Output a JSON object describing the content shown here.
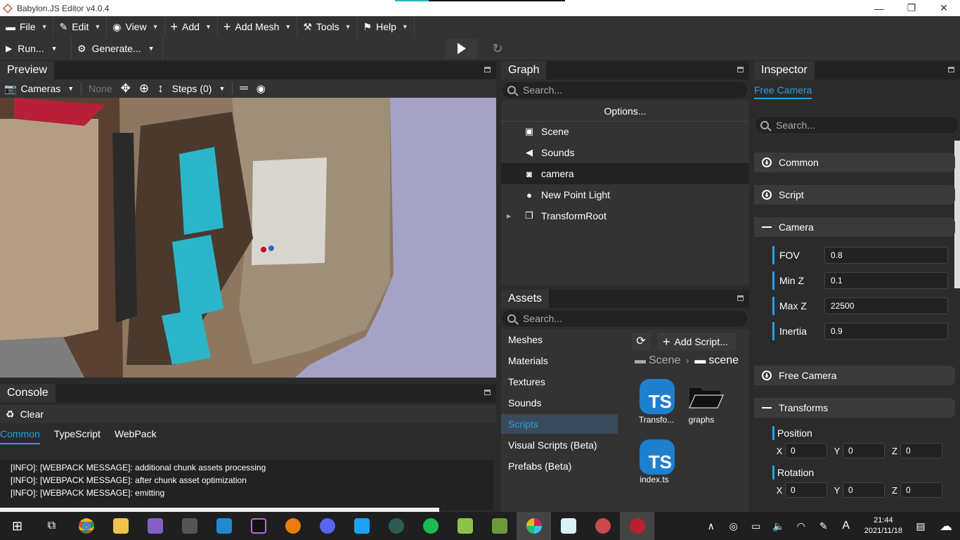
{
  "window": {
    "title": "Babylon.JS Editor v4.0.4",
    "minimize": "—",
    "restore": "❐",
    "close": "✕"
  },
  "menu": [
    {
      "icon": "folder-icon",
      "glyph": "▬",
      "label": "File"
    },
    {
      "icon": "edit-icon",
      "glyph": "✎",
      "label": "Edit"
    },
    {
      "icon": "eye-icon",
      "glyph": "◉",
      "label": "View"
    },
    {
      "icon": "plus-icon",
      "glyph": "+",
      "label": "Add"
    },
    {
      "icon": "plus-icon",
      "glyph": "+",
      "label": "Add Mesh"
    },
    {
      "icon": "wrench-icon",
      "glyph": "🔧",
      "label": "Tools"
    },
    {
      "icon": "signpost-icon",
      "glyph": "⚑",
      "label": "Help"
    }
  ],
  "toolbar": {
    "run": "Run...",
    "generate": "Generate..."
  },
  "preview": {
    "title": "Preview",
    "cameras": "Cameras",
    "none": "None",
    "steps": "Steps (0)"
  },
  "console": {
    "title": "Console",
    "clear": "Clear",
    "tabs": [
      "Common",
      "TypeScript",
      "WebPack"
    ],
    "lines": [
      "[INFO]: [WEBPACK MESSAGE]: additional chunk assets processing",
      "[INFO]: [WEBPACK MESSAGE]: after chunk asset optimization",
      "[INFO]: [WEBPACK MESSAGE]: emitting"
    ]
  },
  "graph": {
    "title": "Graph",
    "search_placeholder": "Search...",
    "options": "Options...",
    "nodes": [
      {
        "label": "Scene",
        "icon": "scene-icon"
      },
      {
        "label": "Sounds",
        "icon": "speaker-icon"
      },
      {
        "label": "camera",
        "icon": "camera-icon"
      },
      {
        "label": "New Point Light",
        "icon": "lightbulb-icon"
      },
      {
        "label": "TransformRoot",
        "icon": "copy-icon"
      }
    ]
  },
  "assets": {
    "title": "Assets",
    "search_placeholder": "Search...",
    "add_script": "Add Script...",
    "categories": [
      "Meshes",
      "Materials",
      "Textures",
      "Sounds",
      "Scripts",
      "Visual Scripts (Beta)",
      "Prefabs (Beta)"
    ],
    "selected_category": "Scripts",
    "breadcrumb": [
      "Scene",
      "scene"
    ],
    "items": [
      {
        "label": "Transfo...",
        "type": "ts"
      },
      {
        "label": "graphs",
        "type": "folder"
      },
      {
        "label": "index.ts",
        "type": "ts"
      }
    ],
    "ts_text": "TS"
  },
  "inspector": {
    "title": "Inspector",
    "tab": "Free Camera",
    "search_placeholder": "Search...",
    "sections": {
      "common": "Common",
      "script": "Script",
      "camera": "Camera",
      "free_camera": "Free Camera",
      "transforms": "Transforms"
    },
    "camera_props": [
      {
        "label": "FOV",
        "value": "0.8"
      },
      {
        "label": "Min Z",
        "value": "0.1"
      },
      {
        "label": "Max Z",
        "value": "22500"
      },
      {
        "label": "Inertia",
        "value": "0.9"
      }
    ],
    "position": {
      "label": "Position",
      "x": "0",
      "y": "0",
      "z": "0"
    },
    "rotation": {
      "label": "Rotation",
      "x": "0",
      "y": "0",
      "z": "0"
    },
    "axis": {
      "x": "X",
      "y": "Y",
      "z": "Z"
    }
  },
  "taskbar": {
    "time": "21:44",
    "date": "2021/11/18",
    "ime": "A"
  },
  "colors": {
    "accent": "#2aa0e0",
    "panel": "#333333",
    "dark": "#222222"
  }
}
